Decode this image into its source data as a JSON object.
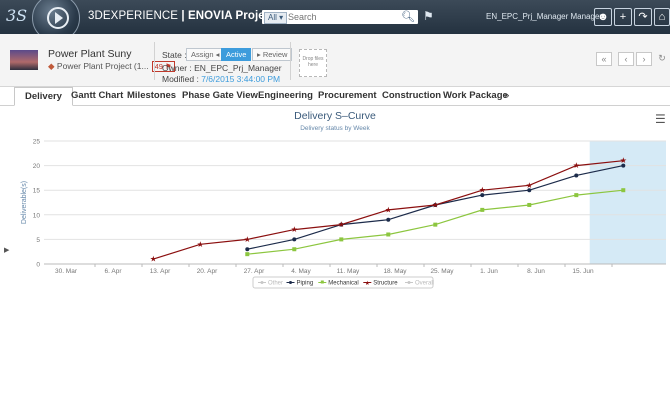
{
  "topbar": {
    "brand_prefix": "3DEXPERIENCE",
    "brand_suffix": " | ENOVIA Project Management",
    "search_scope": "All ▾",
    "search_placeholder": "Search",
    "user": "EN_EPC_Prj_Manager Manager",
    "icons": [
      "user-icon",
      "plus-icon",
      "share-icon",
      "home-icon",
      "help-icon"
    ]
  },
  "header": {
    "title": "Power Plant Suny",
    "subtitle": "Power Plant Project (1...",
    "count": "49",
    "state_label": "State :",
    "states": [
      "Assign ◂",
      "Active",
      "▸ Review"
    ],
    "active_state": "Active",
    "owner": "Owner : EN_EPC_Prj_Manager",
    "modified_label": "Modified : ",
    "modified_value": "7/6/2015 3:44:00 PM",
    "dropzone": "Drop files here",
    "nav_buttons": [
      "«",
      "‹",
      "›",
      "↻"
    ]
  },
  "tabs": {
    "items": [
      "Delivery",
      "Gantt Chart",
      "Milestones",
      "Phase Gate View",
      "Engineering",
      "Procurement",
      "Construction",
      "Work Package",
      "»"
    ],
    "active": "Delivery"
  },
  "chart_data": {
    "type": "line",
    "title": "Delivery S–Curve",
    "subtitle": "Delivery status by Week",
    "xlabel": "",
    "ylabel": "Deliverable(s)",
    "ylim": [
      0,
      25
    ],
    "yticks": [
      0,
      5,
      10,
      15,
      20,
      25
    ],
    "x_ticks": [
      "30. Mar",
      "6. Apr",
      "13. Apr",
      "20. Apr",
      "27. Apr",
      "4. May",
      "11. May",
      "18. May",
      "25. May",
      "1. Jun",
      "8. Jun",
      "15. Jun"
    ],
    "x_range_days": [
      0,
      84
    ],
    "plot_band": {
      "from_day": 78,
      "to_day": 90,
      "color": "#d5eaf6"
    },
    "legend_placement": "bottom",
    "grid": true,
    "series": [
      {
        "name": "Other",
        "color": "#c8c8c8",
        "visible": false,
        "points": []
      },
      {
        "name": "Piping",
        "color": "#1c2b4a",
        "marker": "circle",
        "points": [
          [
            27,
            3
          ],
          [
            34,
            5
          ],
          [
            41,
            8
          ],
          [
            48,
            9
          ],
          [
            55,
            12
          ],
          [
            62,
            14
          ],
          [
            69,
            15
          ],
          [
            76,
            18
          ],
          [
            83,
            20
          ]
        ]
      },
      {
        "name": "Mechanical",
        "color": "#8cc63f",
        "marker": "square",
        "points": [
          [
            27,
            2
          ],
          [
            34,
            3
          ],
          [
            41,
            5
          ],
          [
            48,
            6
          ],
          [
            55,
            8
          ],
          [
            62,
            11
          ],
          [
            69,
            12
          ],
          [
            76,
            14
          ],
          [
            83,
            15
          ]
        ]
      },
      {
        "name": "Structure",
        "color": "#8b0f0f",
        "marker": "star",
        "points": [
          [
            13,
            1
          ],
          [
            20,
            4
          ],
          [
            27,
            5
          ],
          [
            34,
            7
          ],
          [
            41,
            8
          ],
          [
            48,
            11
          ],
          [
            55,
            12
          ],
          [
            62,
            15
          ],
          [
            69,
            16
          ],
          [
            76,
            20
          ],
          [
            83,
            21
          ]
        ]
      },
      {
        "name": "Overall",
        "color": "#c8c8c8",
        "visible": false,
        "points": []
      }
    ]
  }
}
